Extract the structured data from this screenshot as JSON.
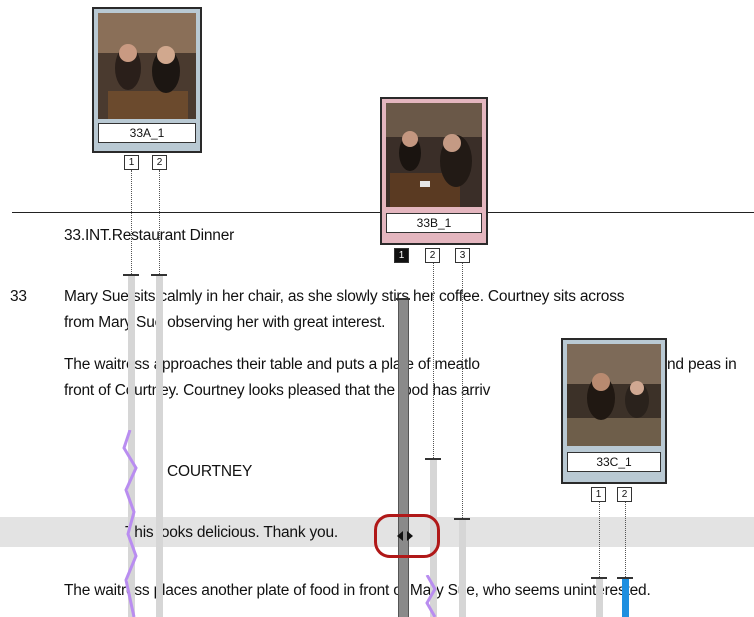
{
  "clips": {
    "a": {
      "label": "33A_1",
      "takes": [
        "1",
        "2"
      ]
    },
    "b": {
      "label": "33B_1",
      "takes": [
        "1",
        "2",
        "3"
      ],
      "active_take": "1"
    },
    "c": {
      "label": "33C_1",
      "takes": [
        "1",
        "2"
      ]
    }
  },
  "script": {
    "scene_heading": "33.INT.Restaurant  Dinner",
    "scene_number": "33",
    "action1_line1": "Mary Sue sits calmly in her chair, as she slowly stirs her coffee.  Courtney sits across",
    "action1_line2": "from Mary Sue observing her with great interest.",
    "action2_line1_a": "The waitress approaches their table and puts a plate of meatlo",
    "action2_line1_b": "nd peas in",
    "action2_line2": "front of Courtney. Courtney looks pleased that the food has arriv",
    "character": "COURTNEY",
    "dialogue": "This looks delicious. Thank you.",
    "action3": "The waitress places another plate of food in front of Mary Sue, who seems uninterested."
  },
  "colors": {
    "highlight_circle": "#b01818",
    "active_take": "#111111",
    "selected_bar": "#1e8fe0",
    "purple_bar": "#c9a6f5"
  }
}
